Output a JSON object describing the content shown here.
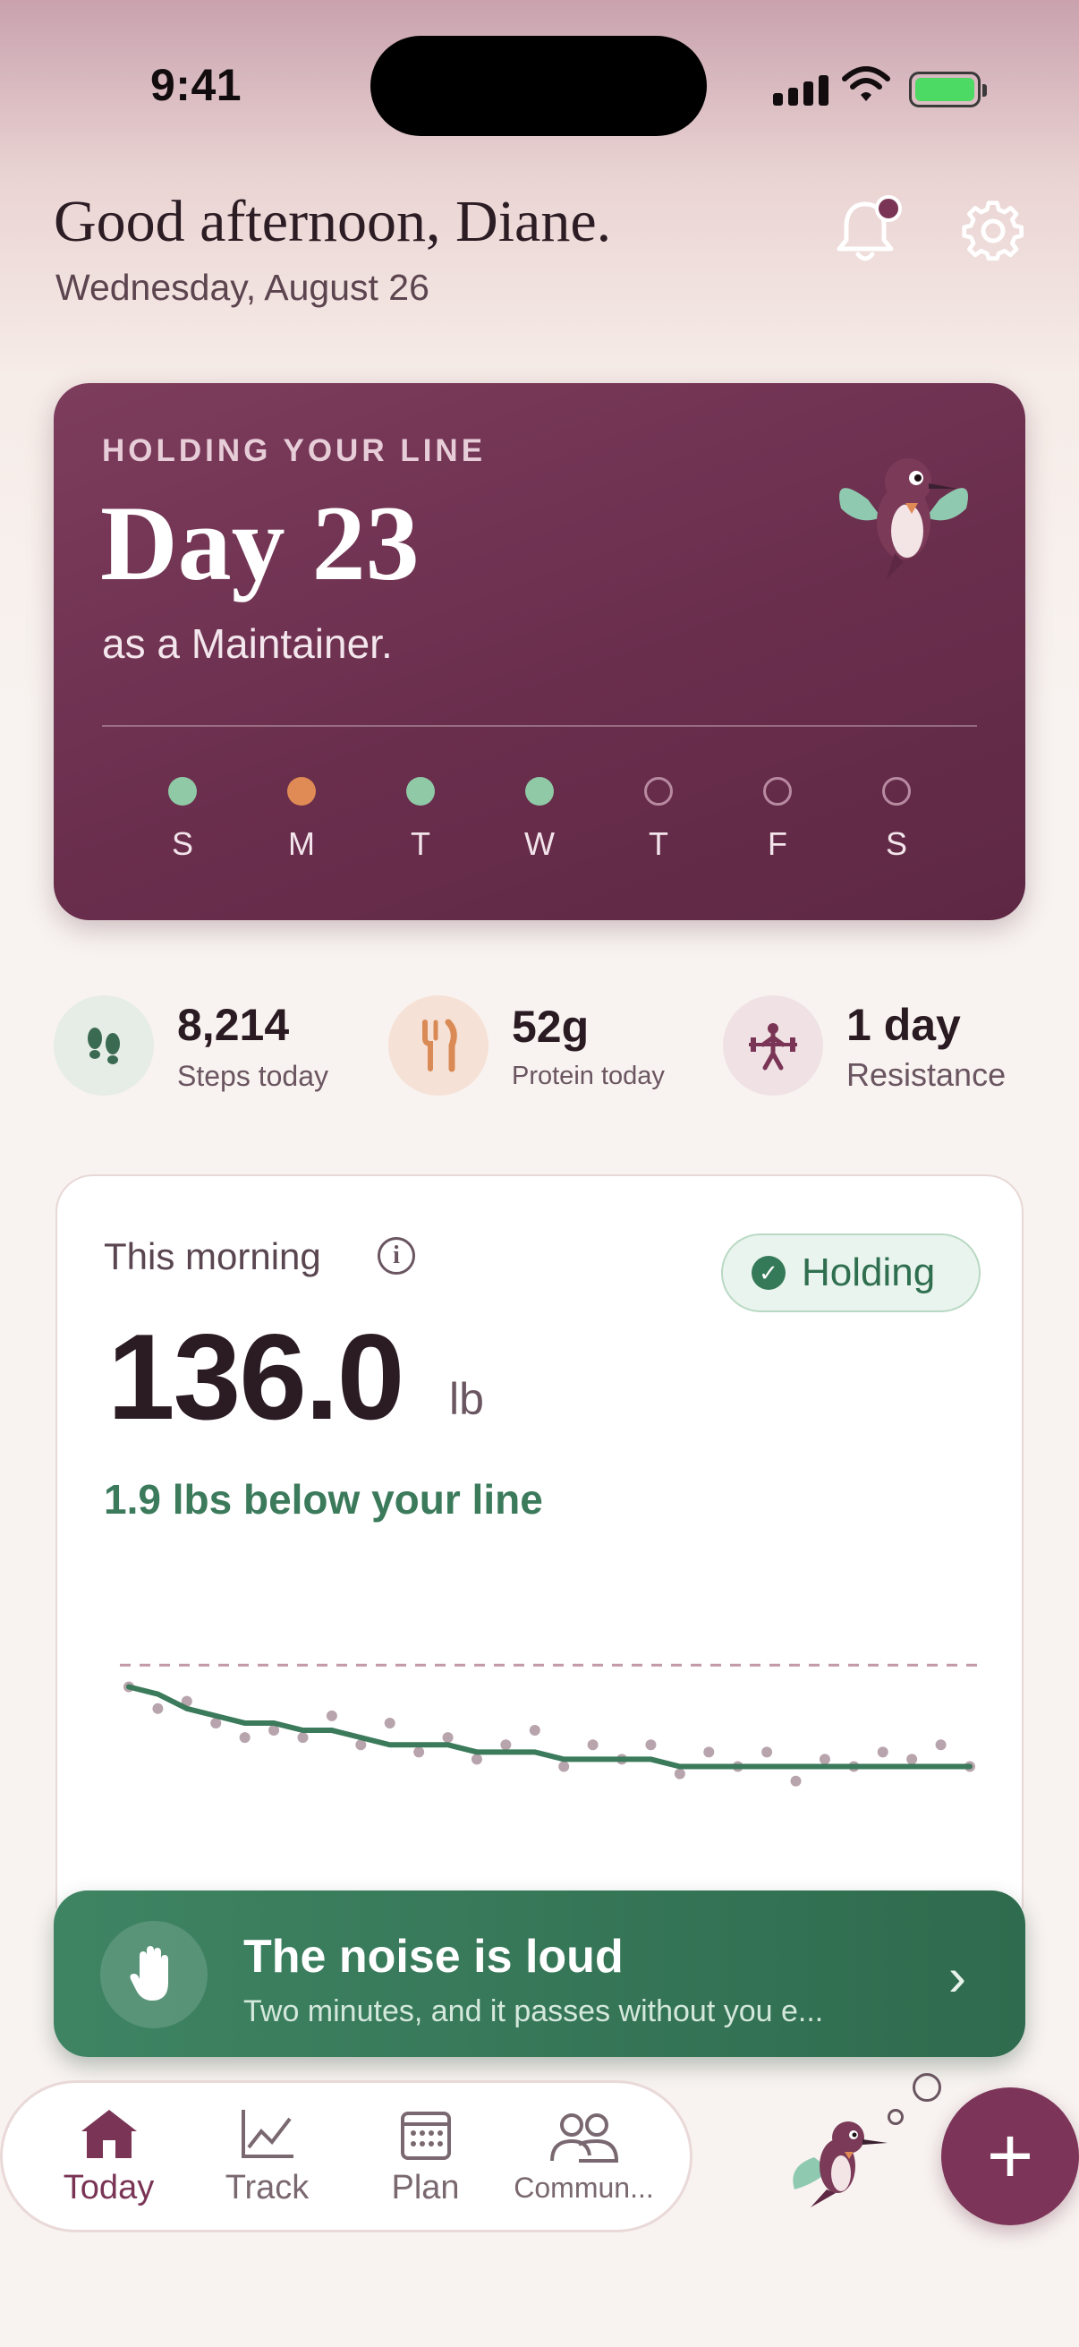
{
  "status": {
    "time": "9:41"
  },
  "header": {
    "greeting": "Good afternoon, Diane.",
    "date": "Wednesday, August 26"
  },
  "hero": {
    "eyebrow": "HOLDING YOUR LINE",
    "day": "Day 23",
    "subtitle": "as a Maintainer.",
    "week": [
      {
        "letter": "S",
        "state": "green"
      },
      {
        "letter": "M",
        "state": "orange"
      },
      {
        "letter": "T",
        "state": "green"
      },
      {
        "letter": "W",
        "state": "green"
      },
      {
        "letter": "T",
        "state": "empty"
      },
      {
        "letter": "F",
        "state": "empty"
      },
      {
        "letter": "S",
        "state": "empty"
      }
    ]
  },
  "stats": [
    {
      "value": "8,214",
      "label": "Steps today",
      "icon": "footprints-icon"
    },
    {
      "value": "52g",
      "label": "Protein today",
      "icon": "fork-knife-icon"
    },
    {
      "value": "1 day",
      "label": "Resistance",
      "icon": "weightlifter-icon"
    }
  ],
  "weight": {
    "label": "This morning",
    "badge": "Holding",
    "value": "136.0",
    "unit": "lb",
    "diff": "1.9 lbs below your line"
  },
  "noise": {
    "title": "The noise is loud",
    "subtitle": "Two minutes, and it passes without you e..."
  },
  "tabs": [
    {
      "label": "Today",
      "icon": "home-icon"
    },
    {
      "label": "Track",
      "icon": "chart-line-icon"
    },
    {
      "label": "Plan",
      "icon": "calendar-icon"
    },
    {
      "label": "Commun...",
      "icon": "people-icon"
    }
  ],
  "colors": {
    "accent": "#7c3458",
    "green": "#3b7a5b",
    "hero": "#6a2e4d"
  },
  "chart_data": {
    "type": "line",
    "series": [
      {
        "values": [
          137.9,
          137.8,
          137.6,
          137.5,
          137.4,
          137.4,
          137.3,
          137.3,
          137.2,
          137.1,
          137.1,
          137.1,
          137.0,
          137.0,
          137.0,
          136.9,
          136.9,
          136.9,
          136.9,
          136.8,
          136.8,
          136.8,
          136.8,
          136.8,
          136.8,
          136.8,
          136.8,
          136.8,
          136.8,
          136.8
        ]
      },
      {
        "values": [
          137.9,
          137.6,
          137.7,
          137.4,
          137.2,
          137.3,
          137.2,
          137.5,
          137.1,
          137.4,
          137.0,
          137.2,
          136.9,
          137.1,
          137.3,
          136.8,
          137.1,
          136.9,
          137.1,
          136.7,
          137.0,
          136.8,
          137.0,
          136.6,
          136.9,
          136.8,
          137.0,
          136.9,
          137.1,
          136.8
        ]
      }
    ],
    "reference_line": 138.2,
    "grid": false
  }
}
